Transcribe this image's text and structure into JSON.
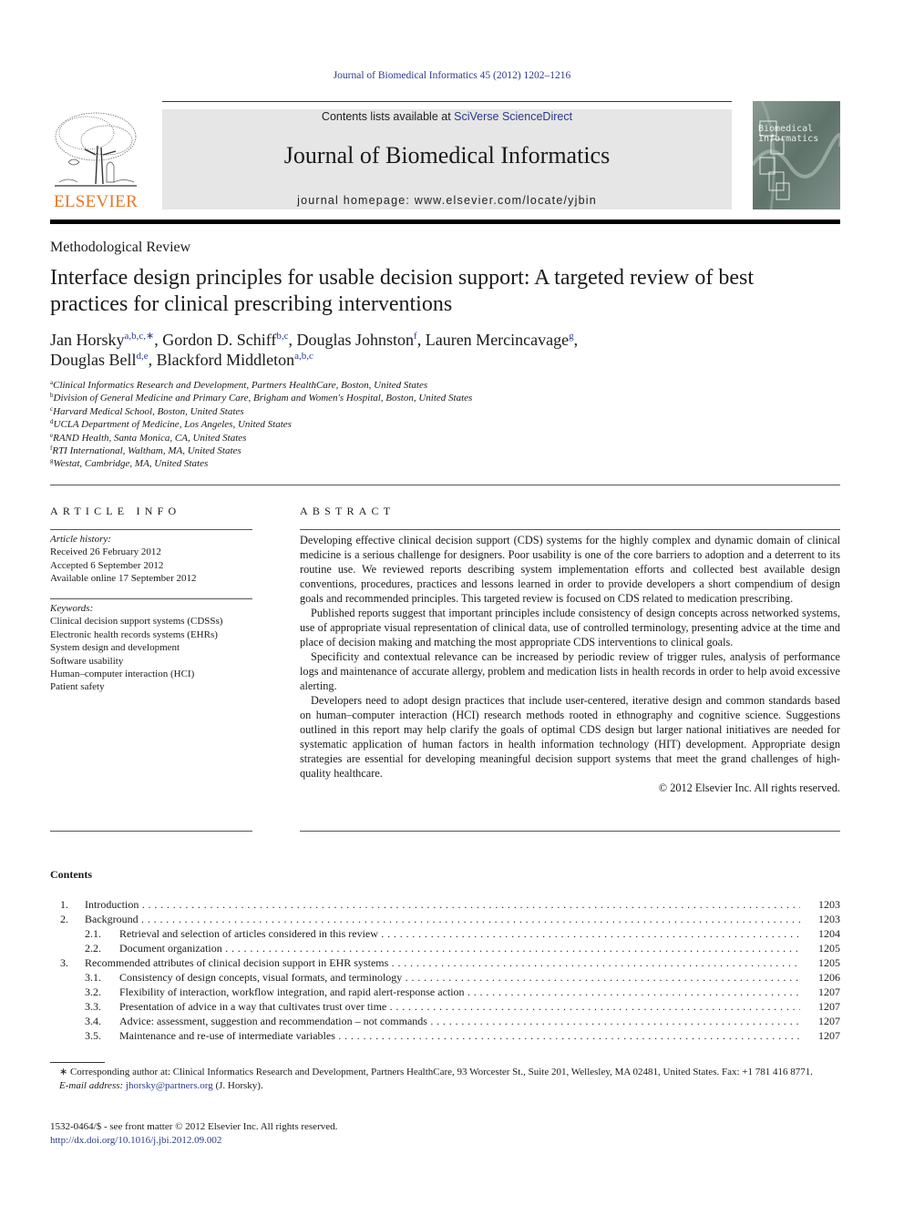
{
  "running_head": "Journal of Biomedical Informatics 45 (2012) 1202–1216",
  "masthead": {
    "publisher_logo_text": "ELSEVIER",
    "contents_prefix": "Contents lists available at ",
    "contents_link": "SciVerse ScienceDirect",
    "journal_title": "Journal of Biomedical Informatics",
    "homepage": "journal homepage: www.elsevier.com/locate/yjbin",
    "cover_title_line1": "Biomedical",
    "cover_title_line2": "Informatics",
    "colors": {
      "elsevier_orange": "#e87722",
      "link_blue": "#2a3a8c",
      "masthead_gray": "#e6e6e6"
    }
  },
  "article": {
    "type": "Methodological Review",
    "title": "Interface design principles for usable decision support: A targeted review of best practices for clinical prescribing interventions",
    "authors": [
      {
        "name": "Jan Horsky",
        "affil": "a,b,c,∗",
        "sep": ", "
      },
      {
        "name": "Gordon D. Schiff",
        "affil": "b,c",
        "sep": ", "
      },
      {
        "name": "Douglas Johnston",
        "affil": "f",
        "sep": ", "
      },
      {
        "name": "Lauren Mercincavage",
        "affil": "g",
        "sep": ","
      },
      {
        "name": "Douglas Bell",
        "affil": "d,e",
        "sep": ", "
      },
      {
        "name": "Blackford Middleton",
        "affil": "a,b,c",
        "sep": ""
      }
    ],
    "affiliations": [
      {
        "key": "a",
        "text": "Clinical Informatics Research and Development, Partners HealthCare, Boston, United States"
      },
      {
        "key": "b",
        "text": "Division of General Medicine and Primary Care, Brigham and Women's Hospital, Boston, United States"
      },
      {
        "key": "c",
        "text": "Harvard Medical School, Boston, United States"
      },
      {
        "key": "d",
        "text": "UCLA Department of Medicine, Los Angeles, United States"
      },
      {
        "key": "e",
        "text": "RAND Health, Santa Monica, CA, United States"
      },
      {
        "key": "f",
        "text": "RTI International, Waltham, MA, United States"
      },
      {
        "key": "g",
        "text": "Westat, Cambridge, MA, United States"
      }
    ]
  },
  "article_info": {
    "heading": "ARTICLE INFO",
    "history_label": "Article history:",
    "history": [
      "Received 26 February 2012",
      "Accepted 6 September 2012",
      "Available online 17 September 2012"
    ],
    "keywords_label": "Keywords:",
    "keywords": [
      "Clinical decision support systems (CDSSs)",
      "Electronic health records systems (EHRs)",
      "System design and development",
      "Software usability",
      "Human–computer interaction (HCI)",
      "Patient safety"
    ]
  },
  "abstract": {
    "heading": "ABSTRACT",
    "paragraphs": [
      "Developing effective clinical decision support (CDS) systems for the highly complex and dynamic domain of clinical medicine is a serious challenge for designers. Poor usability is one of the core barriers to adoption and a deterrent to its routine use. We reviewed reports describing system implementation efforts and collected best available design conventions, procedures, practices and lessons learned in order to provide developers a short compendium of design goals and recommended principles. This targeted review is focused on CDS related to medication prescribing.",
      "Published reports suggest that important principles include consistency of design concepts across networked systems, use of appropriate visual representation of clinical data, use of controlled terminology, presenting advice at the time and place of decision making and matching the most appropriate CDS interventions to clinical goals.",
      "Specificity and contextual relevance can be increased by periodic review of trigger rules, analysis of performance logs and maintenance of accurate allergy, problem and medication lists in health records in order to help avoid excessive alerting.",
      "Developers need to adopt design practices that include user-centered, iterative design and common standards based on human–computer interaction (HCI) research methods rooted in ethnography and cognitive science. Suggestions outlined in this report may help clarify the goals of optimal CDS design but larger national initiatives are needed for systematic application of human factors in health information technology (HIT) development. Appropriate design strategies are essential for developing meaningful decision support systems that meet the grand challenges of high-quality healthcare."
    ],
    "copyright": "© 2012 Elsevier Inc. All rights reserved."
  },
  "contents": {
    "heading": "Contents",
    "items": [
      {
        "num": "1.",
        "title": "Introduction",
        "page": "1203",
        "level": 1
      },
      {
        "num": "2.",
        "title": "Background",
        "page": "1203",
        "level": 1
      },
      {
        "num": "2.1.",
        "title": "Retrieval and selection of articles considered in this review",
        "page": "1204",
        "level": 2
      },
      {
        "num": "2.2.",
        "title": "Document organization",
        "page": "1205",
        "level": 2
      },
      {
        "num": "3.",
        "title": "Recommended attributes of clinical decision support in EHR systems",
        "page": "1205",
        "level": 1
      },
      {
        "num": "3.1.",
        "title": "Consistency of design concepts, visual formats, and terminology",
        "page": "1206",
        "level": 2
      },
      {
        "num": "3.2.",
        "title": "Flexibility of interaction, workflow integration, and rapid alert-response action",
        "page": "1207",
        "level": 2
      },
      {
        "num": "3.3.",
        "title": "Presentation of advice in a way that cultivates trust over time",
        "page": "1207",
        "level": 2
      },
      {
        "num": "3.4.",
        "title": "Advice: assessment, suggestion and recommendation – not commands",
        "page": "1207",
        "level": 2
      },
      {
        "num": "3.5.",
        "title": "Maintenance and re-use of intermediate variables",
        "page": "1207",
        "level": 2
      }
    ]
  },
  "footnotes": {
    "corresponding": "∗ Corresponding author at: Clinical Informatics Research and Development, Partners HealthCare, 93 Worcester St., Suite 201, Wellesley, MA 02481, United States. Fax: +1 781 416 8771.",
    "email_label": "E-mail address: ",
    "email": "jhorsky@partners.org",
    "email_suffix": " (J. Horsky).",
    "issn": "1532-0464/$ - see front matter © 2012 Elsevier Inc. All rights reserved.",
    "doi": "http://dx.doi.org/10.1016/j.jbi.2012.09.002"
  }
}
